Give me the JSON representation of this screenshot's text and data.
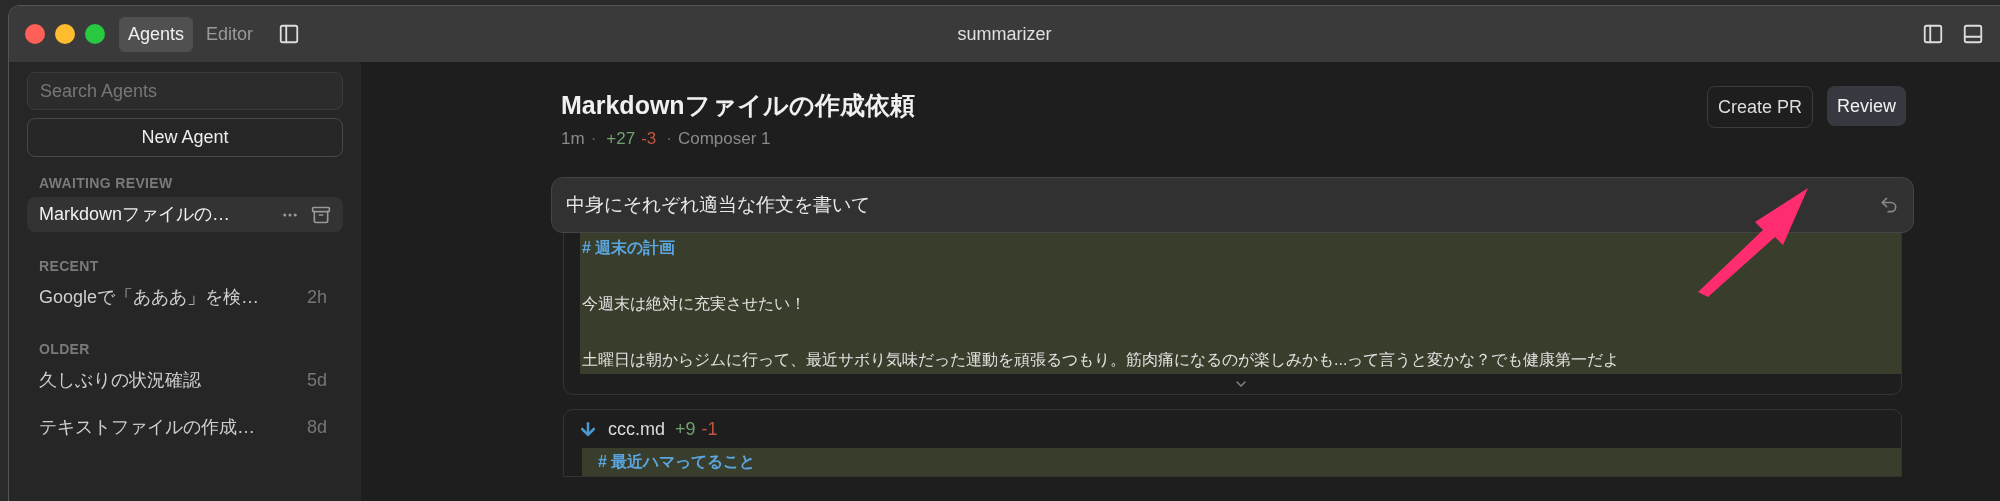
{
  "window": {
    "title": "summarizer",
    "tabs": [
      {
        "label": "Agents",
        "selected": true
      },
      {
        "label": "Editor",
        "selected": false
      }
    ]
  },
  "sidebar": {
    "search": {
      "placeholder": "Search Agents"
    },
    "new_agent": "New Agent",
    "sections": [
      {
        "heading": "AWAITING REVIEW",
        "items": [
          {
            "title": "Markdownファイルの…",
            "selected": true
          }
        ]
      },
      {
        "heading": "RECENT",
        "items": [
          {
            "title": "Googleで「あああ」を検…",
            "time": "2h",
            "selected": false
          }
        ]
      },
      {
        "heading": "OLDER",
        "items": [
          {
            "title": "久しぶりの状況確認",
            "time": "5d",
            "selected": false
          },
          {
            "title": "テキストファイルの作成…",
            "time": "8d",
            "selected": false
          }
        ]
      }
    ]
  },
  "main": {
    "title": "Markdownファイルの作成依頼",
    "meta": {
      "time": "1m",
      "separator_1": "·",
      "added": "+27",
      "removed": "-3",
      "separator_2": "·",
      "model": "Composer 1"
    },
    "buttons": [
      "Create PR",
      "Review"
    ],
    "prompt": "中身にそれぞれ適当な作文を書いて",
    "diffs": [
      {
        "lines": [
          {
            "kind": "heading",
            "text": "#  週末の計画"
          },
          {
            "kind": "blank"
          },
          {
            "kind": "text",
            "text": "今週末は絶対に充実させたい！"
          },
          {
            "kind": "blank"
          },
          {
            "kind": "text",
            "text": "土曜日は朝からジムに行って、最近サボり気味だった運動を頑張るつもり。筋肉痛になるのが楽しみかも...って言うと変かな？でも健康第一だよ"
          }
        ]
      },
      {
        "filename": "ccc.md",
        "added": "+9",
        "removed": "-1",
        "lines": [
          {
            "kind": "heading",
            "text": "#  最近ハマってること"
          }
        ]
      }
    ]
  }
}
